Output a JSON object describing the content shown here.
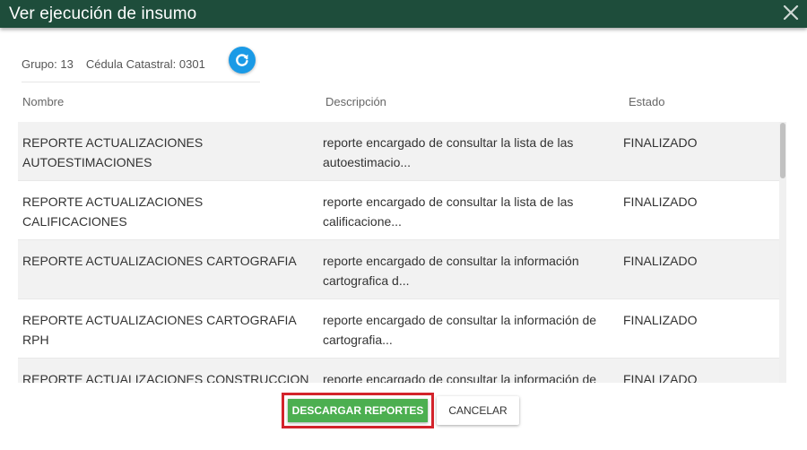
{
  "dialog": {
    "title": "Ver ejecución de insumo",
    "close_icon": "close-icon"
  },
  "info": {
    "group": "Grupo: 13",
    "cadastral": "Cédula Catastral: 0301",
    "refresh_icon": "refresh-icon",
    "refresh_color": "#1a9ae6"
  },
  "table": {
    "headers": {
      "name": "Nombre",
      "description": "Descripción",
      "state": "Estado"
    },
    "rows": [
      {
        "name": [
          "REPORTE ACTUALIZACIONES",
          "AUTOESTIMACIONES"
        ],
        "description": [
          "reporte encargado de consultar la lista de las",
          "autoestimacio..."
        ],
        "state": "FINALIZADO"
      },
      {
        "name": [
          "REPORTE ACTUALIZACIONES CALIFICACIONES"
        ],
        "description": [
          "reporte encargado de consultar la lista de las",
          "calificacione..."
        ],
        "state": "FINALIZADO"
      },
      {
        "name": [
          "REPORTE ACTUALIZACIONES CARTOGRAFIA"
        ],
        "description": [
          "reporte encargado de consultar la información",
          "cartografica d..."
        ],
        "state": "FINALIZADO"
      },
      {
        "name": [
          "REPORTE ACTUALIZACIONES CARTOGRAFIA",
          "RPH"
        ],
        "description": [
          "reporte encargado de consultar la información de",
          "cartografia..."
        ],
        "state": "FINALIZADO"
      },
      {
        "name": [
          "REPORTE ACTUALIZACIONES CONSTRUCCION"
        ],
        "description": [
          "reporte encargado de consultar la información de"
        ],
        "state": "FINALIZADO"
      }
    ]
  },
  "actions": {
    "download_label": "DESCARGAR REPORTES",
    "cancel_label": "CANCELAR"
  },
  "colors": {
    "titlebar": "#1e4d3b",
    "primary_button": "#4caf50",
    "highlight_border": "#d3232b"
  }
}
